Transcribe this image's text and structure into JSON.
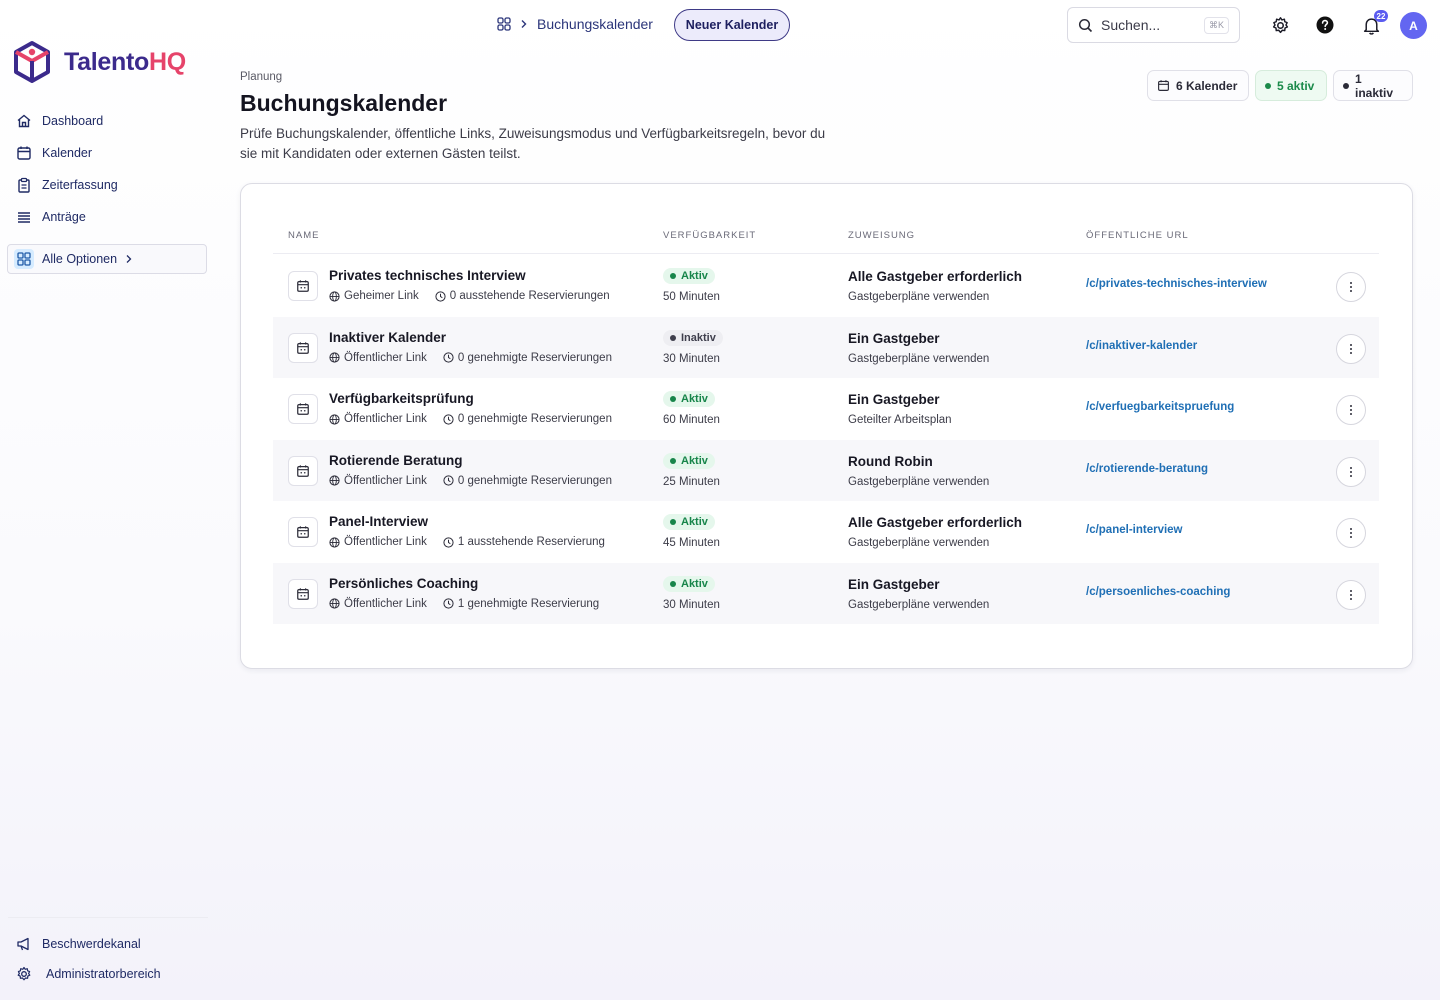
{
  "brand": {
    "name_part1": "Talento",
    "name_part2": "HQ",
    "primary_color": "#3b2a8c",
    "accent_color": "#e6436a"
  },
  "sidebar": {
    "items": [
      {
        "label": "Dashboard",
        "icon": "home-icon"
      },
      {
        "label": "Kalender",
        "icon": "calendar-icon"
      },
      {
        "label": "Zeiterfassung",
        "icon": "clipboard-icon"
      },
      {
        "label": "Anträge",
        "icon": "list-icon"
      }
    ],
    "all_options": {
      "label": "Alle Optionen",
      "icon": "grid-icon"
    },
    "bottom": [
      {
        "label": "Beschwerdekanal",
        "icon": "megaphone-icon"
      },
      {
        "label": "Administratorbereich",
        "icon": "gear-icon"
      }
    ]
  },
  "topbar": {
    "breadcrumb": "Buchungskalender",
    "new_button": "Neuer Kalender",
    "search_placeholder": "Suchen...",
    "search_shortcut": "⌘K",
    "notifications_count": "22",
    "avatar_initial": "A"
  },
  "header": {
    "eyebrow": "Planung",
    "title": "Buchungskalender",
    "description": "Prüfe Buchungskalender, öffentliche Links, Zuweisungsmodus und Verfügbarkeitsregeln, bevor du sie mit Kandidaten oder externen Gästen teilst.",
    "pills": {
      "total": "6 Kalender",
      "active": "5 aktiv",
      "inactive": "1 inaktiv"
    }
  },
  "table": {
    "columns": {
      "name": "NAME",
      "availability": "VERFÜGBARKEIT",
      "assignment": "ZUWEISUNG",
      "url": "ÖFFENTLICHE URL"
    },
    "rows": [
      {
        "name": "Privates technisches Interview",
        "link": "Geheimer Link",
        "reservations": "0 ausstehende Reservierungen",
        "status": "Aktiv",
        "duration": "50 Minuten",
        "assignment": "Alle Gastgeber erforderlich",
        "assignment_sub": "Gastgeberpläne verwenden",
        "url": "/c/privates-technisches-interview"
      },
      {
        "name": "Inaktiver Kalender",
        "link": "Öffentlicher Link",
        "reservations": "0 genehmigte Reservierungen",
        "status": "Inaktiv",
        "duration": "30 Minuten",
        "assignment": "Ein Gastgeber",
        "assignment_sub": "Gastgeberpläne verwenden",
        "url": "/c/inaktiver-kalender"
      },
      {
        "name": "Verfügbarkeitsprüfung",
        "link": "Öffentlicher Link",
        "reservations": "0 genehmigte Reservierungen",
        "status": "Aktiv",
        "duration": "60 Minuten",
        "assignment": "Ein Gastgeber",
        "assignment_sub": "Geteilter Arbeitsplan",
        "url": "/c/verfuegbarkeitspruefung"
      },
      {
        "name": "Rotierende Beratung",
        "link": "Öffentlicher Link",
        "reservations": "0 genehmigte Reservierungen",
        "status": "Aktiv",
        "duration": "25 Minuten",
        "assignment": "Round Robin",
        "assignment_sub": "Gastgeberpläne verwenden",
        "url": "/c/rotierende-beratung"
      },
      {
        "name": "Panel-Interview",
        "link": "Öffentlicher Link",
        "reservations": "1 ausstehende Reservierung",
        "status": "Aktiv",
        "duration": "45 Minuten",
        "assignment": "Alle Gastgeber erforderlich",
        "assignment_sub": "Gastgeberpläne verwenden",
        "url": "/c/panel-interview"
      },
      {
        "name": "Persönliches Coaching",
        "link": "Öffentlicher Link",
        "reservations": "1 genehmigte Reservierung",
        "status": "Aktiv",
        "duration": "30 Minuten",
        "assignment": "Ein Gastgeber",
        "assignment_sub": "Gastgeberpläne verwenden",
        "url": "/c/persoenliches-coaching"
      }
    ]
  }
}
